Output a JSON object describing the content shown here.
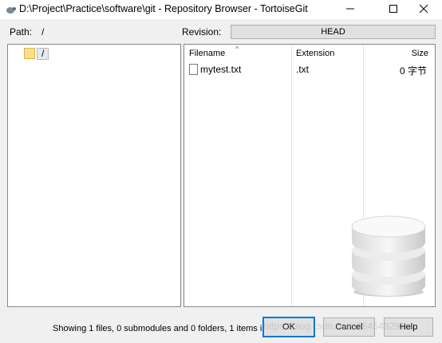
{
  "window": {
    "title": "D:\\Project\\Practice\\software\\git - Repository Browser - TortoiseGit",
    "controls": [
      "minimize",
      "maximize",
      "close"
    ]
  },
  "path": {
    "label": "Path:",
    "value": "/"
  },
  "revision": {
    "label": "Revision:",
    "value": "HEAD"
  },
  "tree": {
    "items": [
      {
        "label": "/",
        "icon": "folder-icon"
      }
    ]
  },
  "file_list": {
    "columns": [
      "Filename",
      "Extension",
      "Size"
    ],
    "rows": [
      {
        "name": "mytest.txt",
        "extension": ".txt",
        "size": "0 字节",
        "icon": "text-file-icon"
      }
    ]
  },
  "status_text": "Showing 1 files, 0 submodules and 0 folders, 1 items in total",
  "buttons": {
    "ok": "OK",
    "cancel": "Cancel",
    "help": "Help"
  },
  "watermark": "https://blog.csdn.net/a954543291",
  "colors": {
    "accent": "#0078d7",
    "folder": "#f8e08a"
  }
}
